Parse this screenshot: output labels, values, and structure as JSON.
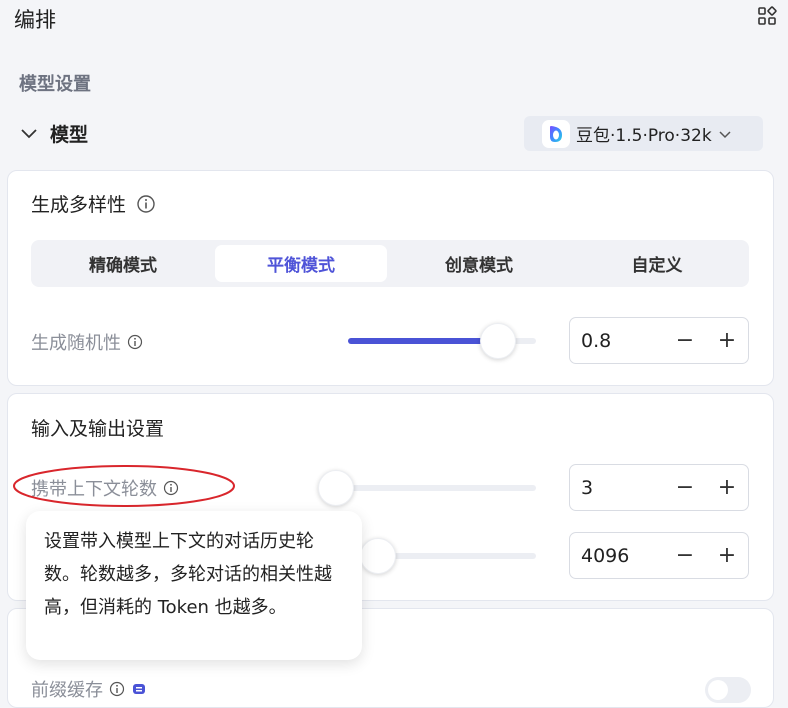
{
  "header": {
    "title": "编排"
  },
  "model_settings": {
    "section_title": "模型设置",
    "model_label": "模型",
    "model_name": "豆包·1.5·Pro·32k"
  },
  "diversity": {
    "title": "生成多样性",
    "modes": [
      {
        "label": "精确模式",
        "active": false
      },
      {
        "label": "平衡模式",
        "active": true
      },
      {
        "label": "创意模式",
        "active": false
      },
      {
        "label": "自定义",
        "active": false
      }
    ],
    "randomness": {
      "label": "生成随机性",
      "value": "0.8",
      "fraction": 0.8
    }
  },
  "io": {
    "title": "输入及输出设置",
    "context_rounds": {
      "label": "携带上下文轮数",
      "value": "3",
      "fraction": 0.0
    },
    "max_tokens": {
      "value": "4096",
      "fraction": 0.3
    }
  },
  "tooltip": {
    "text": "设置带入模型上下文的对话历史轮数。轮数越多，多轮对话的相关性越高，但消耗的 Token 也越多。"
  },
  "prefix_cache": {
    "label": "前缀缓存"
  },
  "stepper": {
    "minus": "−",
    "plus": "+"
  },
  "colors": {
    "accent": "#4a53d6",
    "annotation": "#d9262c"
  }
}
